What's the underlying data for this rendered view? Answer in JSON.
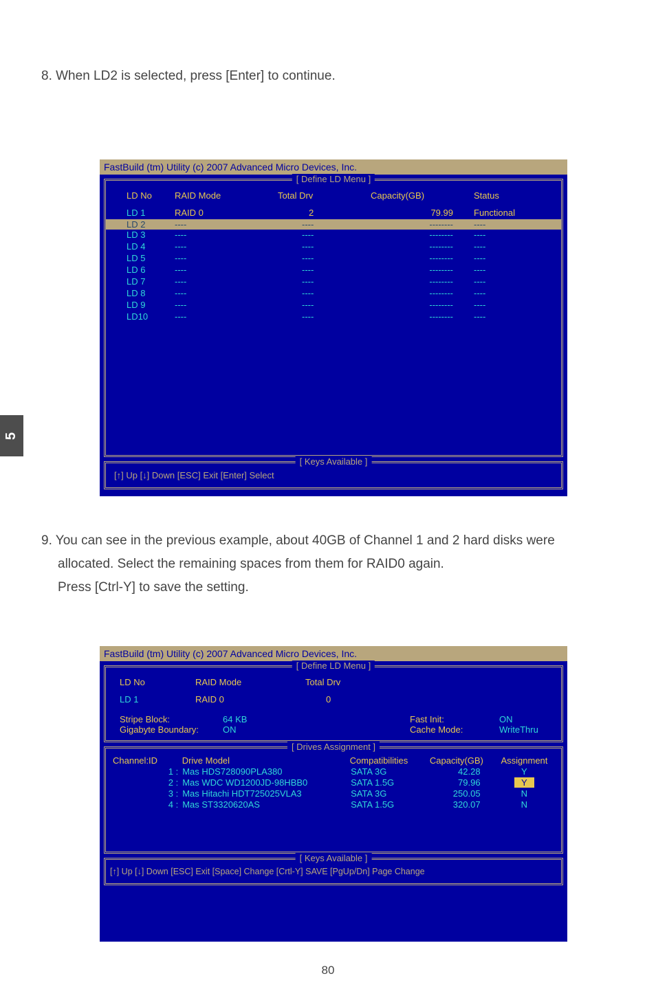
{
  "instr1": "8. When LD2 is selected, press [Enter] to continue.",
  "instr2_a": "9. You can see in the previous example, about 40GB of Channel 1 and 2 hard disks were",
  "instr2_b": "allocated. Select the remaining spaces from them for RAID0 again.",
  "instr2_c": "Press [Ctrl-Y] to save the setting.",
  "side_tab": "5",
  "page_num": "80",
  "title_bar": "FastBuild (tm) Utility (c) 2007 Advanced Micro Devices, Inc.",
  "define_menu": "[ Define LD Menu ]",
  "keys_available": "[ Keys Available ]",
  "drives_assignment": "[ Drives Assignment ]",
  "p1": {
    "headers": {
      "ldno": "LD No",
      "raid": "RAID Mode",
      "tdrv": "Total Drv",
      "cap": "Capacity(GB)",
      "status": "Status"
    },
    "active": {
      "ldno": "LD  1",
      "raid": "RAID 0",
      "tdrv": "2",
      "cap": "79.99",
      "status": "Functional"
    },
    "selected": {
      "ldno": "LD  2",
      "raid": "----",
      "tdrv": "----",
      "cap": "--------",
      "status": "----"
    },
    "rows": [
      {
        "ldno": "LD  3",
        "raid": "----",
        "tdrv": "----",
        "cap": "--------",
        "status": "----"
      },
      {
        "ldno": "LD  4",
        "raid": "----",
        "tdrv": "----",
        "cap": "--------",
        "status": "----"
      },
      {
        "ldno": "LD  5",
        "raid": "----",
        "tdrv": "----",
        "cap": "--------",
        "status": "----"
      },
      {
        "ldno": "LD  6",
        "raid": "----",
        "tdrv": "----",
        "cap": "--------",
        "status": "----"
      },
      {
        "ldno": "LD  7",
        "raid": "----",
        "tdrv": "----",
        "cap": "--------",
        "status": "----"
      },
      {
        "ldno": "LD  8",
        "raid": "----",
        "tdrv": "----",
        "cap": "--------",
        "status": "----"
      },
      {
        "ldno": "LD  9",
        "raid": "----",
        "tdrv": "----",
        "cap": "--------",
        "status": "----"
      },
      {
        "ldno": "LD10",
        "raid": "----",
        "tdrv": "----",
        "cap": "--------",
        "status": "----"
      }
    ],
    "keys": "[↑] Up    [↓] Down    [ESC] Exit    [Enter] Select"
  },
  "p2": {
    "top": {
      "h_ldno": "LD No",
      "h_raid": "RAID Mode",
      "h_tdrv": "Total Drv",
      "v_ldno": "LD  1",
      "v_raid": "RAID 0",
      "v_tdrv": "0",
      "stripe_label": "Stripe Block:",
      "stripe_val": "64   KB",
      "gb_label": "Gigabyte Boundary:",
      "gb_val": "ON",
      "fi_label": "Fast Init:",
      "fi_val": "ON",
      "cm_label": "Cache Mode:",
      "cm_val": "WriteThru"
    },
    "dr_head": {
      "ch": "Channel",
      "id": ":ID",
      "model": "Drive Model",
      "comp": "Compatibilities",
      "cap": "Capacity(GB)",
      "assign": "Assignment"
    },
    "drives": [
      {
        "id": "1 :",
        "model": "Mas HDS728090PLA380",
        "comp": "SATA  3G",
        "cap": "42.28",
        "assign": "Y",
        "hl": false
      },
      {
        "id": "2 :",
        "model": "Mas WDC WD1200JD-98HBB0",
        "comp": "SATA  1.5G",
        "cap": "79.96",
        "assign": "Y",
        "hl": true
      },
      {
        "id": "3 :",
        "model": "Mas Hitachi HDT725025VLA3",
        "comp": "SATA  3G",
        "cap": "250.05",
        "assign": "N",
        "hl": false
      },
      {
        "id": "4 :",
        "model": "Mas ST3320620AS",
        "comp": "SATA  1.5G",
        "cap": "320.07",
        "assign": "N",
        "hl": false
      }
    ],
    "keys": "[↑] Up  [↓] Down  [ESC] Exit  [Space] Change  [Crtl-Y] SAVE   [PgUp/Dn] Page Change"
  }
}
